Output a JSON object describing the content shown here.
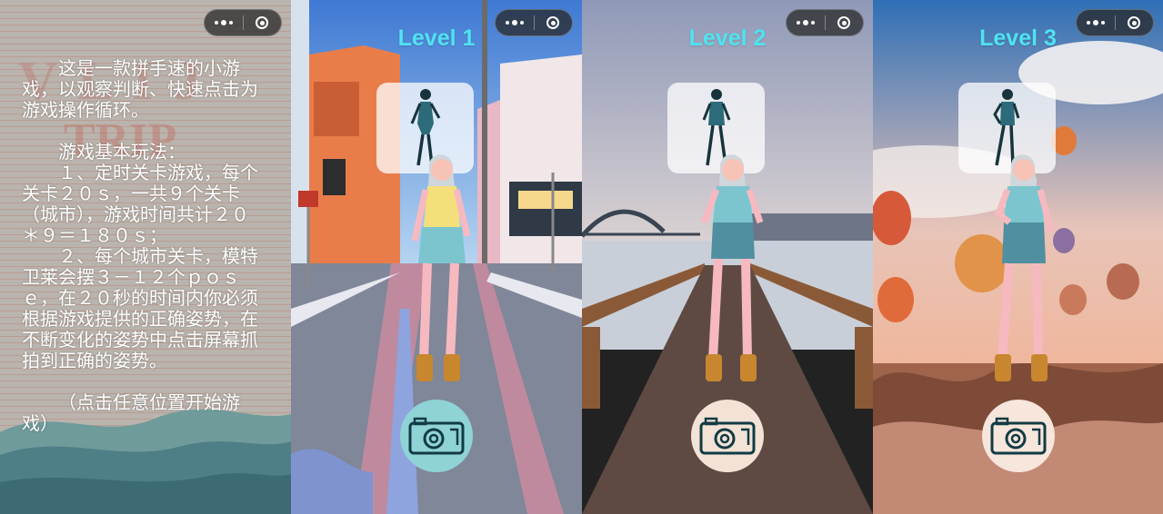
{
  "capsule": {
    "more_icon": "more-dots-icon",
    "close_icon": "close-circle-icon"
  },
  "intro": {
    "paragraphs": [
      "这是一款拼手速的小游戏，以观察判断、快速点击为游戏操作循环。",
      "游戏基本玩法：",
      "１、定时关卡游戏，每个关卡２０ｓ，一共９个关卡（城市），游戏时间共计２０＊９＝１８０ｓ；",
      "２、每个城市关卡，模特卫莱会摆３－１２个ｐｏｓｅ，在２０秒的时间内你必须根据游戏提供的正确姿势，在不断变化的姿势中点击屏幕抓拍到正确的姿势。",
      "（点击任意位置开始游戏）"
    ]
  },
  "levels": [
    {
      "title": "Level 1",
      "scene": "city-street",
      "button_bg": "#8fd3d6"
    },
    {
      "title": "Level 2",
      "scene": "harbour-pier",
      "button_bg": "#f3e3d6"
    },
    {
      "title": "Level 3",
      "scene": "balloon-valley",
      "button_bg": "#f6e6dc"
    }
  ],
  "colors": {
    "title": "#4fe3f0",
    "icon_stroke": "#123b44"
  }
}
